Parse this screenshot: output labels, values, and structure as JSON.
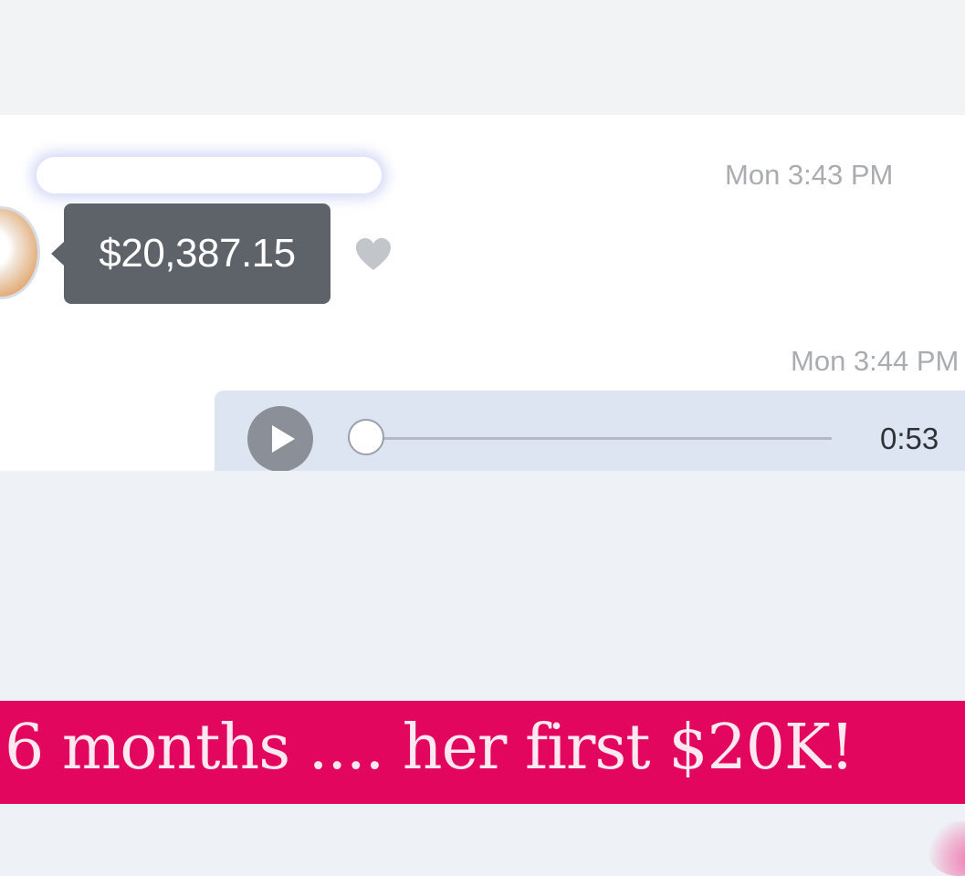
{
  "conversation": {
    "message_1": {
      "timestamp": "Mon 3:43 PM",
      "amount": "$20,387.15"
    },
    "message_2": {
      "timestamp": "Mon 3:44 PM",
      "audio_duration": "0:53",
      "audio_progress": 0
    }
  },
  "caption": {
    "text": "6 months .... her first $20K!"
  },
  "icons": {
    "reaction": "heart-icon",
    "audio_control": "play-icon"
  },
  "colors": {
    "money_bubble": "#5e6369",
    "audio_bubble": "#dde5f2",
    "caption_background": "#e3065f",
    "caption_text": "#ffe8f0"
  }
}
